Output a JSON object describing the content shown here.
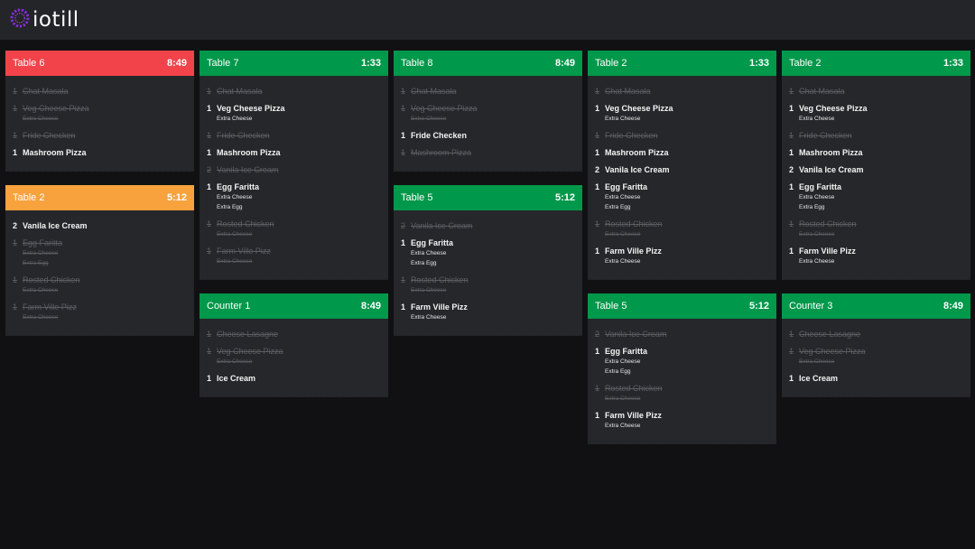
{
  "app": {
    "brand": "iotill"
  },
  "colors": {
    "red": "#f2434a",
    "orange": "#f7a23c",
    "green": "#00984a"
  },
  "columns": [
    {
      "tickets": [
        {
          "name": "Table 6",
          "time": "8:49",
          "color": "red",
          "items": [
            {
              "qty": "1",
              "name": "Chat Masala",
              "done": true,
              "mods": []
            },
            {
              "qty": "1",
              "name": "Veg Cheese Pizza",
              "done": true,
              "mods": [
                "Extra Cheese"
              ]
            },
            {
              "qty": "1",
              "name": "Fride Checken",
              "done": true,
              "mods": []
            },
            {
              "qty": "1",
              "name": "Mashroom Pizza",
              "done": false,
              "mods": []
            }
          ]
        },
        {
          "name": "Table 2",
          "time": "5:12",
          "color": "orange",
          "items": [
            {
              "qty": "2",
              "name": "Vanila Ice Cream",
              "done": false,
              "mods": []
            },
            {
              "qty": "1",
              "name": "Egg Faritta",
              "done": true,
              "mods": [
                "Extra Cheese",
                "Extra Egg"
              ]
            },
            {
              "qty": "1",
              "name": "Rosted Chicken",
              "done": true,
              "mods": [
                "Extra Cheese"
              ]
            },
            {
              "qty": "1",
              "name": "Farm Ville Pizz",
              "done": true,
              "mods": [
                "Extra Cheese"
              ]
            }
          ]
        }
      ]
    },
    {
      "tickets": [
        {
          "name": "Table 7",
          "time": "1:33",
          "color": "green",
          "items": [
            {
              "qty": "1",
              "name": "Chat Masala",
              "done": true,
              "mods": []
            },
            {
              "qty": "1",
              "name": "Veg Cheese Pizza",
              "done": false,
              "mods": [
                "Extra Cheese"
              ]
            },
            {
              "qty": "1",
              "name": "Fride Checken",
              "done": true,
              "mods": []
            },
            {
              "qty": "1",
              "name": "Mashroom Pizza",
              "done": false,
              "mods": []
            },
            {
              "qty": "2",
              "name": "Vanila Ice Cream",
              "done": true,
              "mods": []
            },
            {
              "qty": "1",
              "name": "Egg Faritta",
              "done": false,
              "mods": [
                "Extra Cheese",
                "Extra Egg"
              ]
            },
            {
              "qty": "1",
              "name": "Rosted Chicken",
              "done": true,
              "mods": [
                "Extra Cheese"
              ]
            },
            {
              "qty": "1",
              "name": "Farm Ville Pizz",
              "done": true,
              "mods": [
                "Extra Cheese"
              ]
            }
          ]
        },
        {
          "name": "Counter 1",
          "time": "8:49",
          "color": "green",
          "items": [
            {
              "qty": "1",
              "name": "Cheese Lasagne",
              "done": true,
              "mods": []
            },
            {
              "qty": "1",
              "name": "Veg Cheese Pizza",
              "done": true,
              "mods": [
                "Extra Cheese"
              ]
            },
            {
              "qty": "1",
              "name": "Ice Cream",
              "done": false,
              "mods": []
            }
          ]
        }
      ]
    },
    {
      "tickets": [
        {
          "name": "Table 8",
          "time": "8:49",
          "color": "green",
          "items": [
            {
              "qty": "1",
              "name": "Chat Masala",
              "done": true,
              "mods": []
            },
            {
              "qty": "1",
              "name": "Veg Cheese Pizza",
              "done": true,
              "mods": [
                "Extra Cheese"
              ]
            },
            {
              "qty": "1",
              "name": "Fride Checken",
              "done": false,
              "mods": []
            },
            {
              "qty": "1",
              "name": "Mashroom Pizza",
              "done": true,
              "mods": []
            }
          ]
        },
        {
          "name": "Table 5",
          "time": "5:12",
          "color": "green",
          "items": [
            {
              "qty": "2",
              "name": "Vanila Ice Cream",
              "done": true,
              "mods": []
            },
            {
              "qty": "1",
              "name": "Egg Faritta",
              "done": false,
              "mods": [
                "Extra Cheese",
                "Extra Egg"
              ]
            },
            {
              "qty": "1",
              "name": "Rosted Chicken",
              "done": true,
              "mods": [
                "Extra Cheese"
              ]
            },
            {
              "qty": "1",
              "name": "Farm Ville Pizz",
              "done": false,
              "mods": [
                "Extra Cheese"
              ]
            }
          ]
        }
      ]
    },
    {
      "tickets": [
        {
          "name": "Table 2",
          "time": "1:33",
          "color": "green",
          "items": [
            {
              "qty": "1",
              "name": "Chat Masala",
              "done": true,
              "mods": []
            },
            {
              "qty": "1",
              "name": "Veg Cheese Pizza",
              "done": false,
              "mods": [
                "Extra Cheese"
              ]
            },
            {
              "qty": "1",
              "name": "Fride Checken",
              "done": true,
              "mods": []
            },
            {
              "qty": "1",
              "name": "Mashroom Pizza",
              "done": false,
              "mods": []
            },
            {
              "qty": "2",
              "name": "Vanila Ice Cream",
              "done": false,
              "mods": []
            },
            {
              "qty": "1",
              "name": "Egg Faritta",
              "done": false,
              "mods": [
                "Extra Cheese",
                "Extra Egg"
              ]
            },
            {
              "qty": "1",
              "name": "Rosted Chicken",
              "done": true,
              "mods": [
                "Extra Cheese"
              ]
            },
            {
              "qty": "1",
              "name": "Farm Ville Pizz",
              "done": false,
              "mods": [
                "Extra Cheese"
              ]
            }
          ]
        },
        {
          "name": "Table 5",
          "time": "5:12",
          "color": "green",
          "items": [
            {
              "qty": "2",
              "name": "Vanila Ice Cream",
              "done": true,
              "mods": []
            },
            {
              "qty": "1",
              "name": "Egg Faritta",
              "done": false,
              "mods": [
                "Extra Cheese",
                "Extra Egg"
              ]
            },
            {
              "qty": "1",
              "name": "Rosted Chicken",
              "done": true,
              "mods": [
                "Extra Cheese"
              ]
            },
            {
              "qty": "1",
              "name": "Farm Ville Pizz",
              "done": false,
              "mods": [
                "Extra Cheese"
              ]
            }
          ]
        }
      ]
    },
    {
      "tickets": [
        {
          "name": "Table 2",
          "time": "1:33",
          "color": "green",
          "items": [
            {
              "qty": "1",
              "name": "Chat Masala",
              "done": true,
              "mods": []
            },
            {
              "qty": "1",
              "name": "Veg Cheese Pizza",
              "done": false,
              "mods": [
                "Extra Cheese"
              ]
            },
            {
              "qty": "1",
              "name": "Fride Checken",
              "done": true,
              "mods": []
            },
            {
              "qty": "1",
              "name": "Mashroom Pizza",
              "done": false,
              "mods": []
            },
            {
              "qty": "2",
              "name": "Vanila Ice Cream",
              "done": false,
              "mods": []
            },
            {
              "qty": "1",
              "name": "Egg Faritta",
              "done": false,
              "mods": [
                "Extra Cheese",
                "Extra Egg"
              ]
            },
            {
              "qty": "1",
              "name": "Rosted Chicken",
              "done": true,
              "mods": [
                "Extra Cheese"
              ]
            },
            {
              "qty": "1",
              "name": "Farm Ville Pizz",
              "done": false,
              "mods": [
                "Extra Cheese"
              ]
            }
          ]
        },
        {
          "name": "Counter 3",
          "time": "8:49",
          "color": "green",
          "items": [
            {
              "qty": "1",
              "name": "Cheese Lasagne",
              "done": true,
              "mods": []
            },
            {
              "qty": "1",
              "name": "Veg Cheese Pizza",
              "done": true,
              "mods": [
                "Extra Cheese"
              ]
            },
            {
              "qty": "1",
              "name": "Ice Cream",
              "done": false,
              "mods": []
            }
          ]
        }
      ]
    }
  ]
}
